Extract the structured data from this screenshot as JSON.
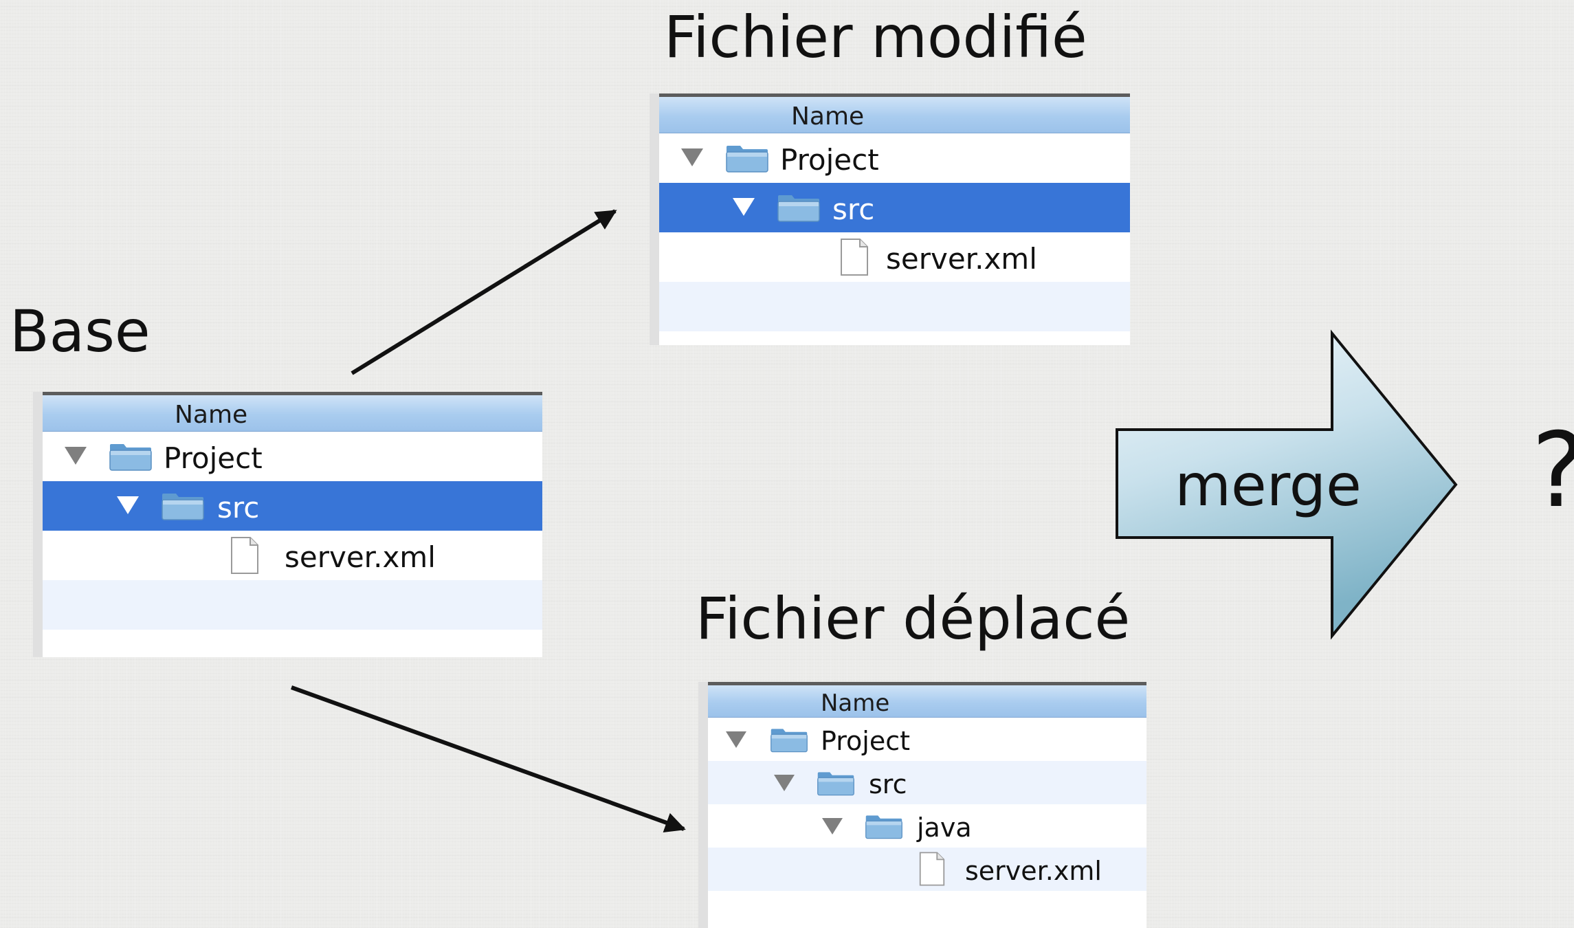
{
  "labels": {
    "base": "Base",
    "modified": "Fichier modifié",
    "moved": "Fichier déplacé",
    "merge": "merge",
    "result": "?"
  },
  "base_window": {
    "header": "Name",
    "rows": [
      {
        "type": "folder",
        "label": "Project",
        "expanded": true,
        "selected": false
      },
      {
        "type": "folder",
        "label": "src",
        "expanded": true,
        "selected": true
      },
      {
        "type": "file",
        "label": "server.xml",
        "selected": false
      }
    ]
  },
  "modified_window": {
    "header": "Name",
    "rows": [
      {
        "type": "folder",
        "label": "Project",
        "expanded": true,
        "selected": false
      },
      {
        "type": "folder",
        "label": "src",
        "expanded": true,
        "selected": true
      },
      {
        "type": "file",
        "label": "server.xml",
        "selected": false
      }
    ]
  },
  "moved_window": {
    "header": "Name",
    "rows": [
      {
        "type": "folder",
        "label": "Project",
        "expanded": true,
        "selected": false
      },
      {
        "type": "folder",
        "label": "src",
        "expanded": true,
        "selected": false
      },
      {
        "type": "folder",
        "label": "java",
        "expanded": true,
        "selected": false
      },
      {
        "type": "file",
        "label": "server.xml",
        "selected": false
      }
    ]
  },
  "colors": {
    "selection": "#3875d7",
    "alt_row": "#edf3fd",
    "folder_blue": "#7fb2de",
    "merge_arrow_light": "#e9f3f8",
    "merge_arrow_dark": "#86b9cc"
  },
  "icons": [
    "disclosure-triangle-icon",
    "folder-icon",
    "file-icon",
    "arrow-icon"
  ]
}
